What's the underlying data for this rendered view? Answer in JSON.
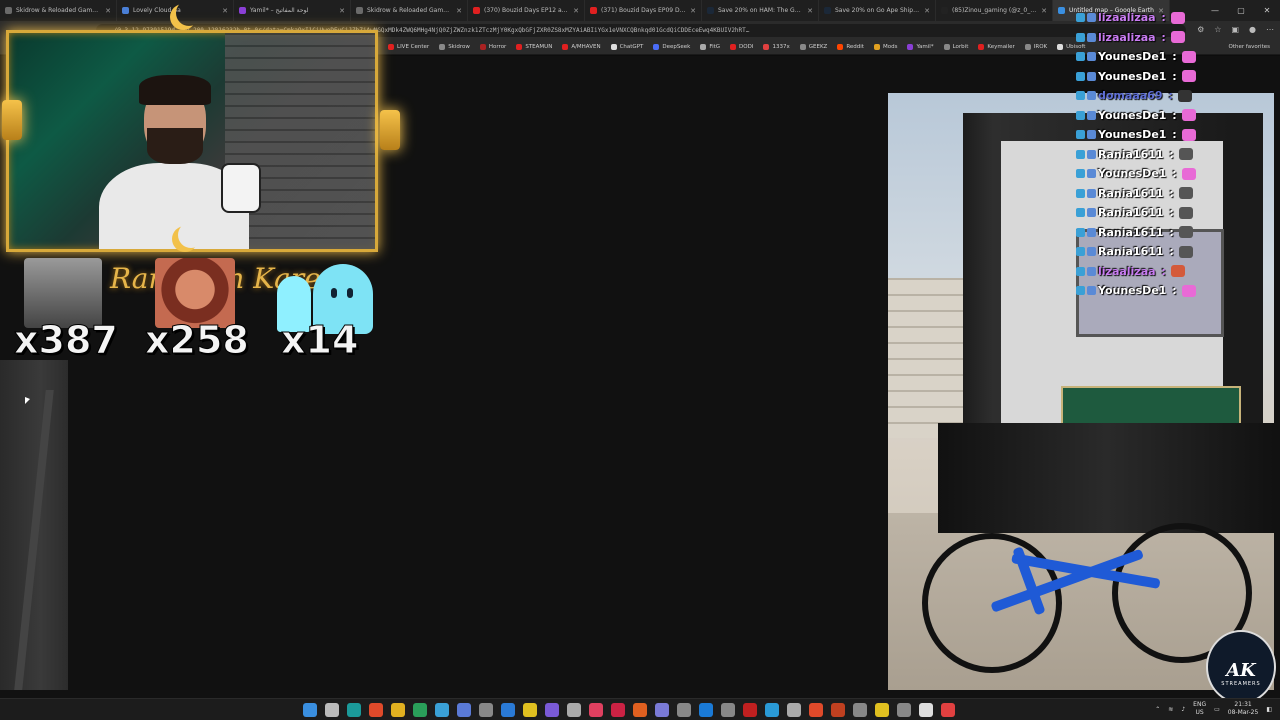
{
  "browser": {
    "tabs": [
      {
        "label": "Skidrow & Reloaded Games – Da",
        "color": "#6a6a6a"
      },
      {
        "label": "Lovely Cloud Sa",
        "color": "#4a7fd6"
      },
      {
        "label": "Yamil* – لوحة المفاتيح",
        "color": "#8a3fd6"
      },
      {
        "label": "Skidrow & Reloaded Games – Da",
        "color": "#6a6a6a"
      },
      {
        "label": "(370) Bouzid Days EP12 analyse",
        "color": "#e02020"
      },
      {
        "label": "(371) Bouzid Days EP09 Doctor",
        "color": "#e02020"
      },
      {
        "label": "Save 20% on HAM: The Game on",
        "color": "#1b2838"
      },
      {
        "label": "Save 20% on Go Ape Ship! on St",
        "color": "#1b2838"
      },
      {
        "label": "(85)Zinou_gaming (@z_0_z0) | Ti",
        "color": "#222222"
      },
      {
        "label": "Untitled map – Google Earth",
        "color": "#3a8fe0",
        "active": true
      }
    ],
    "window_controls": [
      "—",
      "▢",
      "✕"
    ],
    "url": "…/@…3,12.97391519d,35y,200.12816232h,0t,0r/data=CmkaOxI1CiUweDEyCjJZhZjAwNGQxMDk4ZWQ6MHg4NjQ0ZjZWZnzk1ZTczMjY0KgxQbGFjZXR0ZS8xMZYAiABIiYGx1eVNXCQBnkqd01GcdQiCDDEceEwq4KBUIV2hRT…",
    "bookmarks": [
      {
        "label": "LIVE Center",
        "color": "#e02020"
      },
      {
        "label": "Skidrow",
        "color": "#888888"
      },
      {
        "label": "Horror",
        "color": "#aa2222"
      },
      {
        "label": "STEAMUN",
        "color": "#e02020"
      },
      {
        "label": "A/MHAVEN",
        "color": "#e02020"
      },
      {
        "label": "ChatGPT",
        "color": "#dddddd"
      },
      {
        "label": "DeepSeek",
        "color": "#4a6cf7"
      },
      {
        "label": "FitG",
        "color": "#aaaaaa"
      },
      {
        "label": "DODI",
        "color": "#e02020"
      },
      {
        "label": "1337x",
        "color": "#e04040"
      },
      {
        "label": "GEEKZ",
        "color": "#888888"
      },
      {
        "label": "Reddit",
        "color": "#ff4500"
      },
      {
        "label": "Mods",
        "color": "#e0a020"
      },
      {
        "label": "Yamil*",
        "color": "#8a3fd6"
      },
      {
        "label": "Lorbit",
        "color": "#888888"
      },
      {
        "label": "Keymailer",
        "color": "#e02020"
      },
      {
        "label": "IROK",
        "color": "#888888"
      },
      {
        "label": "Ubisoft",
        "color": "#dddddd"
      }
    ],
    "other_favorites": "Other favorites"
  },
  "stream": {
    "banner": "Ramadan Kareem",
    "emotes": [
      {
        "count": "x387"
      },
      {
        "count": "x258"
      },
      {
        "count": "x14"
      }
    ]
  },
  "chat": [
    {
      "user": "lizaalizaa",
      "color": "#c97cf2"
    },
    {
      "user": "lizaalizaa",
      "color": "#c97cf2"
    },
    {
      "user": "YounesDe1",
      "color": "#ffffff"
    },
    {
      "user": "YounesDe1",
      "color": "#ffffff"
    },
    {
      "user": "domaaa69",
      "color": "#5f6fd6"
    },
    {
      "user": "YounesDe1",
      "color": "#ffffff"
    },
    {
      "user": "YounesDe1",
      "color": "#ffffff"
    },
    {
      "user": "Rania1611",
      "color": "#ffffff"
    },
    {
      "user": "YounesDe1",
      "color": "#ffffff"
    },
    {
      "user": "Rania1611",
      "color": "#ffffff"
    },
    {
      "user": "Rania1611",
      "color": "#ffffff"
    },
    {
      "user": "Rania1611",
      "color": "#ffffff"
    },
    {
      "user": "Rania1611",
      "color": "#ffffff"
    },
    {
      "user": "lizaalizaa",
      "color": "#c97cf2"
    },
    {
      "user": "YounesDe1",
      "color": "#ffffff"
    }
  ],
  "logo": {
    "main": "AK",
    "sub": "STREAMERS"
  },
  "taskbar": {
    "language": "ENG\nUS",
    "time": "21:31",
    "date": "08-Mar-25"
  }
}
